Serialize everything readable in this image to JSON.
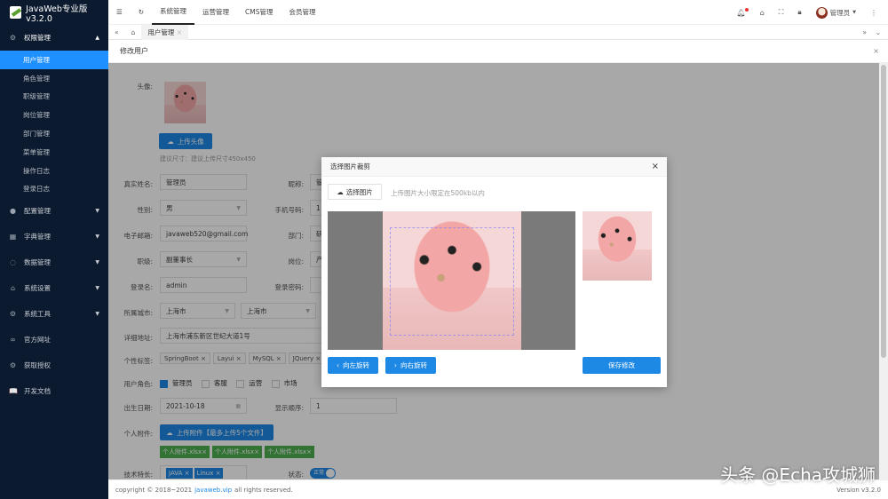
{
  "app": {
    "title": "JavaWeb专业版v3.2.0"
  },
  "sidebar": {
    "items": [
      {
        "label": "权限管理",
        "icon": "gear-icon",
        "expanded": true,
        "children": [
          "用户管理",
          "角色管理",
          "职级管理",
          "岗位管理",
          "部门管理",
          "菜单管理",
          "操作日志",
          "登录日志"
        ]
      },
      {
        "label": "配置管理",
        "icon": "gear-icon"
      },
      {
        "label": "字典管理",
        "icon": "dictionary-icon"
      },
      {
        "label": "数据管理",
        "icon": "data-icon"
      },
      {
        "label": "系统设置",
        "icon": "home-icon"
      },
      {
        "label": "系统工具",
        "icon": "gear-icon"
      },
      {
        "label": "官方网址",
        "icon": "link-icon"
      },
      {
        "label": "获取授权",
        "icon": "gear-icon"
      },
      {
        "label": "开发文档",
        "icon": "book-icon"
      }
    ]
  },
  "topnav": {
    "tabs": [
      "系统管理",
      "运营管理",
      "CMS管理",
      "会员管理"
    ],
    "user": "管理员"
  },
  "tabs": {
    "current": "用户管理"
  },
  "page": {
    "title": "修改用户"
  },
  "form": {
    "avatar_label": "头像:",
    "upload_avatar": "上传头像",
    "avatar_hint": "建议尺寸：建议上传尺寸450x450",
    "realname_label": "真实姓名:",
    "realname": "管理员",
    "nickname_label": "昵称:",
    "nickname": "管",
    "gender_label": "性别:",
    "gender": "男",
    "phone_label": "手机号码:",
    "phone": "1",
    "email_label": "电子邮箱:",
    "email": "javaweb520@gmail.com",
    "dept_label": "部门:",
    "dept": "研",
    "level_label": "职级:",
    "level": "副董事长",
    "position_label": "岗位:",
    "position": "产",
    "username_label": "登录名:",
    "username": "admin",
    "password_label": "登录密码:",
    "city_label": "所属城市:",
    "province": "上海市",
    "city": "上海市",
    "address_label": "详细地址:",
    "address": "上海市浦东新区世纪大道1号",
    "tags_label": "个性标签:",
    "tags": [
      "SpringBoot",
      "Layui",
      "MySQL",
      "JQuery"
    ],
    "roles_label": "用户角色:",
    "roles": [
      {
        "label": "管理员",
        "checked": true
      },
      {
        "label": "客服",
        "checked": false
      },
      {
        "label": "运营",
        "checked": false
      },
      {
        "label": "市场",
        "checked": false
      }
    ],
    "birthday_label": "出生日期:",
    "birthday": "2021-10-18",
    "sort_label": "显示顺序:",
    "sort": "1",
    "attach_label": "个人附件:",
    "upload_attach": "上传附件【最多上传5个文件】",
    "attachments": [
      "个人附件.xlsx",
      "个人附件.xlsx",
      "个人附件.xlsx"
    ],
    "skills_label": "技术特长:",
    "skills": [
      "JAVA",
      "Linux"
    ],
    "status_label": "状态:",
    "status": "正常"
  },
  "modal": {
    "title": "选择图片裁剪",
    "choose": "选择图片",
    "hint": "上传图片大小限定在500kb以内",
    "rotate_left": "向左旋转",
    "rotate_right": "向右旋转",
    "save": "保存修改"
  },
  "footer": {
    "copyright": "copyright © 2018~2021",
    "link": "javaweb.vip",
    "rights": "all rights reserved.",
    "version": "Version v3.2.0"
  },
  "watermark": "头条 @Echa攻城狮"
}
